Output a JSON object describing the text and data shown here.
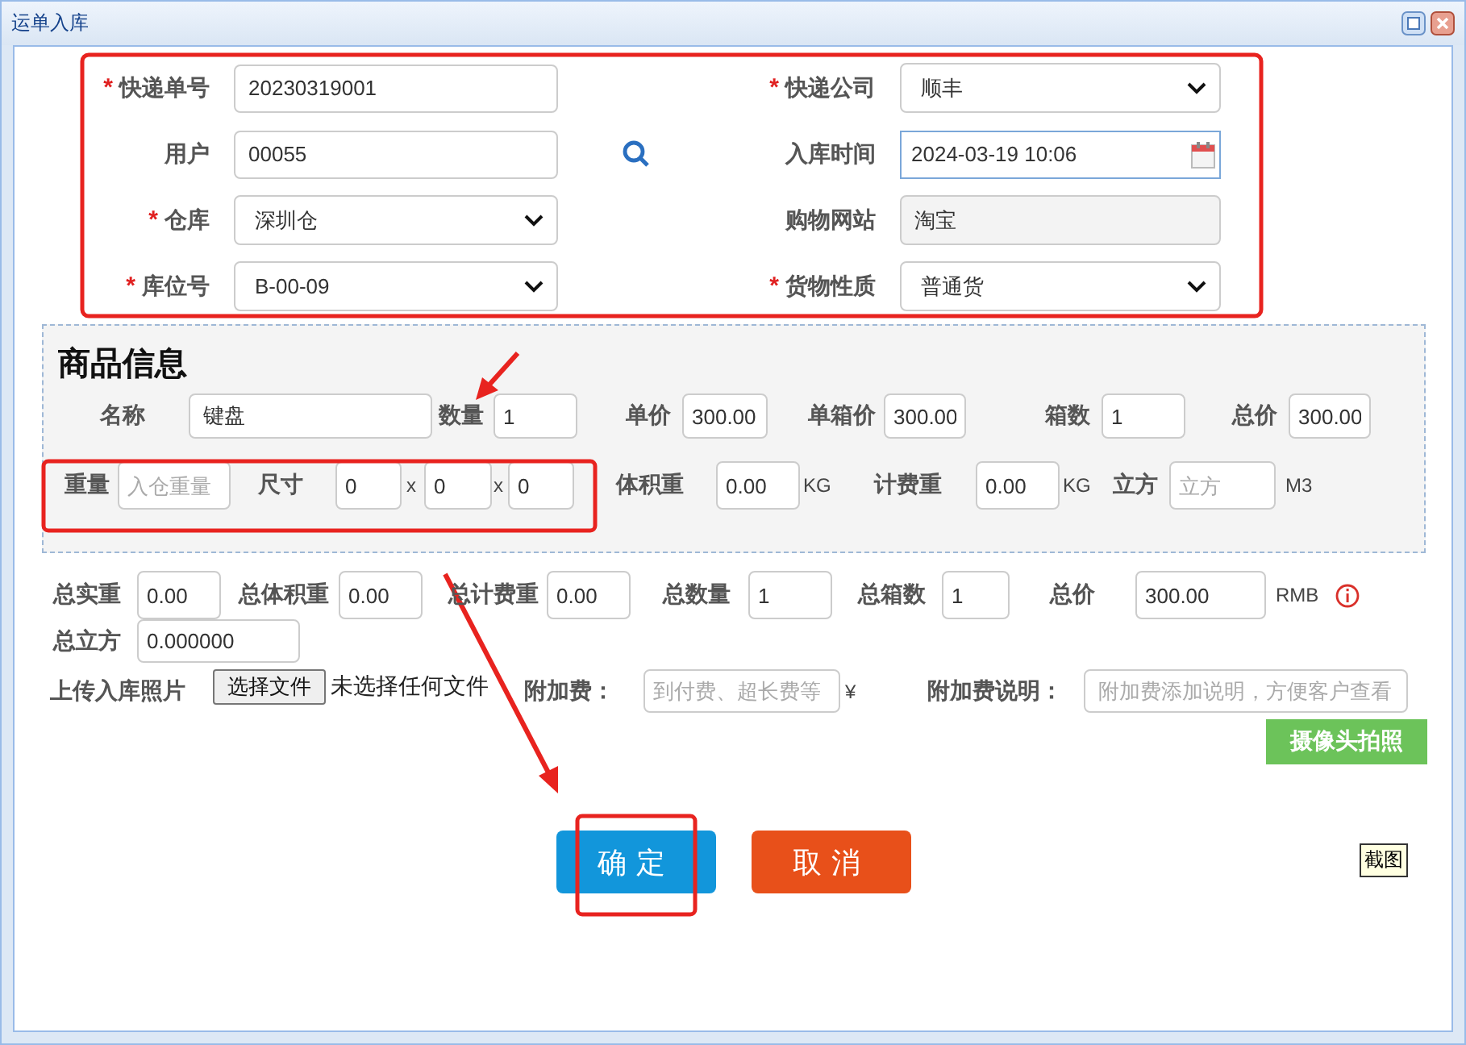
{
  "window": {
    "title": "运单入库"
  },
  "shipment": [
    {
      "left": {
        "required_mark": "*",
        "label": "快递单号",
        "kind": "input",
        "value": "20230319001"
      },
      "search": false,
      "right": {
        "required_mark": "*",
        "label": "快递公司",
        "kind": "select",
        "value": "顺丰"
      }
    },
    {
      "left": {
        "label": "用户",
        "kind": "input",
        "value": "00055"
      },
      "search": true,
      "right": {
        "label": "入库时间",
        "kind": "date",
        "value": "2024-03-19 10:06"
      }
    },
    {
      "left": {
        "required_mark": "*",
        "label": "仓库",
        "kind": "select",
        "value": "深圳仓"
      },
      "search": false,
      "right": {
        "label": "购物网站",
        "kind": "readonly",
        "value": "淘宝"
      }
    },
    {
      "left": {
        "required_mark": "*",
        "label": "库位号",
        "kind": "select",
        "value": "B-00-09"
      },
      "search": false,
      "right": {
        "required_mark": "*",
        "label": "货物性质",
        "kind": "select",
        "value": "普通货"
      }
    }
  ],
  "goods": {
    "title": "商品信息",
    "row_1": [
      {
        "kind": "label",
        "text": "名称"
      },
      {
        "kind": "input",
        "value": "键盘"
      },
      {
        "kind": "label",
        "text": "数量"
      },
      {
        "kind": "input",
        "value": "1"
      },
      {
        "kind": "label",
        "text": "单价"
      },
      {
        "kind": "input",
        "value": "300.00"
      },
      {
        "kind": "label",
        "text": "单箱价"
      },
      {
        "kind": "input",
        "value": "300.00"
      },
      {
        "kind": "label",
        "text": "箱数"
      },
      {
        "kind": "input",
        "value": "1"
      },
      {
        "kind": "label",
        "text": "总价"
      },
      {
        "kind": "input",
        "value": "300.00"
      }
    ],
    "row_2": [
      {
        "kind": "label",
        "text": "重量"
      },
      {
        "kind": "input",
        "placeholder": "入仓重量"
      },
      {
        "kind": "label",
        "text": "尺寸"
      },
      {
        "kind": "input",
        "value": "0"
      },
      {
        "kind": "unit",
        "text": "x"
      },
      {
        "kind": "input",
        "value": "0"
      },
      {
        "kind": "unit",
        "text": "x"
      },
      {
        "kind": "input",
        "value": "0"
      },
      {
        "kind": "label",
        "text": "体积重"
      },
      {
        "kind": "input",
        "value": "0.00"
      },
      {
        "kind": "unit",
        "text": "KG"
      },
      {
        "kind": "label",
        "text": "计费重"
      },
      {
        "kind": "input",
        "value": "0.00"
      },
      {
        "kind": "unit",
        "text": "KG"
      },
      {
        "kind": "label",
        "text": "立方"
      },
      {
        "kind": "input",
        "placeholder": "立方"
      },
      {
        "kind": "unit",
        "text": "M3"
      }
    ]
  },
  "totals": {
    "row_1": [
      {
        "kind": "label",
        "text": "总实重"
      },
      {
        "kind": "input",
        "value": "0.00"
      },
      {
        "kind": "label",
        "text": "总体积重"
      },
      {
        "kind": "input",
        "value": "0.00"
      },
      {
        "kind": "label",
        "text": "总计费重"
      },
      {
        "kind": "input",
        "value": "0.00"
      },
      {
        "kind": "label",
        "text": "总数量"
      },
      {
        "kind": "input",
        "value": "1"
      },
      {
        "kind": "label",
        "text": "总箱数"
      },
      {
        "kind": "input",
        "value": "1"
      },
      {
        "kind": "label",
        "text": "总价"
      },
      {
        "kind": "input",
        "value": "300.00"
      },
      {
        "kind": "unit",
        "text": "RMB"
      },
      {
        "kind": "info"
      }
    ],
    "row_2": [
      {
        "kind": "label",
        "text": "总立方"
      },
      {
        "kind": "input",
        "value": "0.000000"
      }
    ],
    "row_3": [
      {
        "kind": "label",
        "text": "上传入库照片"
      },
      {
        "kind": "file",
        "text": "选择文件"
      },
      {
        "kind": "note",
        "text": "未选择任何文件"
      },
      {
        "kind": "label",
        "text": "附加费："
      },
      {
        "kind": "input",
        "placeholder": "到付费、超长费等"
      },
      {
        "kind": "unit",
        "text": "¥"
      },
      {
        "kind": "label",
        "text": "附加费说明："
      },
      {
        "kind": "input",
        "placeholder": "附加费添加说明，方便客户查看"
      }
    ]
  },
  "camera_button": "摄像头拍照",
  "actions": [
    {
      "kind": "confirm",
      "label": "确定"
    },
    {
      "kind": "cancel",
      "label": "取消"
    }
  ],
  "tooltip": "截图"
}
